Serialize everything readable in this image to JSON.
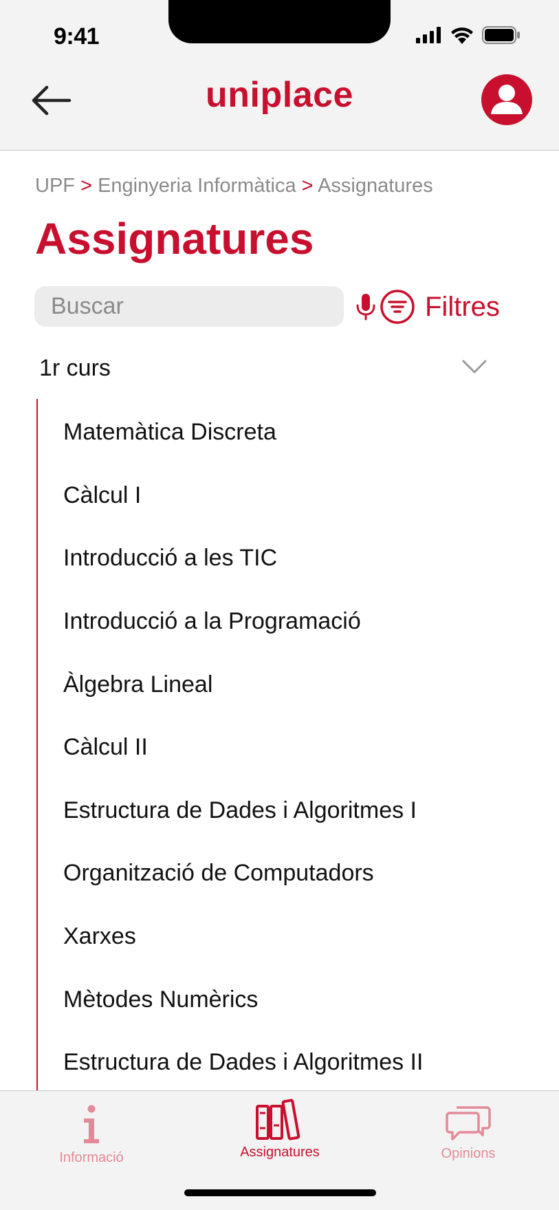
{
  "status_bar": {
    "time": "9:41"
  },
  "header": {
    "logo": "uniplace"
  },
  "breadcrumb": {
    "items": [
      "UPF",
      "Enginyeria Informàtica",
      "Assignatures"
    ],
    "separator": ">"
  },
  "page_title": "Assignatures",
  "search": {
    "placeholder": "Buscar",
    "value": ""
  },
  "filters": {
    "label": "Filtres"
  },
  "section": {
    "title": "1r curs",
    "items": [
      "Matemàtica Discreta",
      "Càlcul I",
      "Introducció a les TIC",
      "Introducció a la Programació",
      "Àlgebra Lineal",
      "Càlcul II",
      "Estructura de Dades i Algoritmes I",
      "Organització de Computadors",
      "Xarxes",
      "Mètodes Numèrics",
      "Estructura de Dades i Algoritmes II"
    ]
  },
  "tabbar": {
    "tabs": [
      {
        "label": "Informació",
        "icon": "info-icon",
        "active": false
      },
      {
        "label": "Assignatures",
        "icon": "books-icon",
        "active": true
      },
      {
        "label": "Opinions",
        "icon": "chat-bubbles-icon",
        "active": false
      }
    ]
  },
  "colors": {
    "accent": "#c8102e",
    "accent_light": "#e38a98",
    "header_bg": "#f3f3f3"
  }
}
